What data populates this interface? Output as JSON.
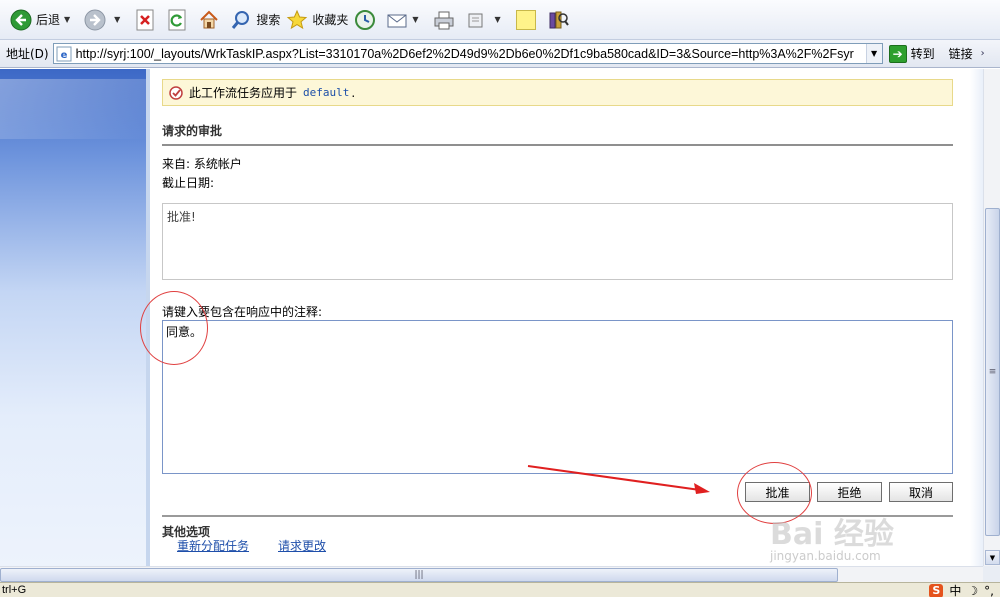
{
  "toolbar": {
    "back_label": "后退",
    "search_label": "搜索",
    "favorites_label": "收藏夹"
  },
  "address_bar": {
    "label": "地址(D)",
    "url": "http://syrj:100/_layouts/WrkTaskIP.aspx?List=3310170a%2D6ef2%2D49d9%2Db6e0%2Df1c9ba580cad&ID=3&Source=http%3A%2F%2Fsyr",
    "go_label": "转到",
    "links_label": "链接"
  },
  "notice": {
    "text": "此工作流任务应用于",
    "target": "default",
    "dot": "."
  },
  "task": {
    "title": "请求的审批",
    "from": "来自: 系统帐户",
    "due": "截止日期:",
    "message": "批准!"
  },
  "comment": {
    "label": "请键入要包含在响应中的注释:",
    "value": "同意。"
  },
  "buttons": {
    "approve": "批准",
    "reject": "拒绝",
    "cancel": "取消"
  },
  "other_options": {
    "title": "其他选项",
    "reassign": "重新分配任务",
    "request_change": "请求更改"
  },
  "watermark": {
    "main": "Bai 经验",
    "sub": "jingyan.baidu.com"
  },
  "statusbar": {
    "text": "trl+G",
    "ime_label": "中"
  },
  "colors": {
    "notice_bg": "#fdf7d8",
    "link": "#1f4faa",
    "annotation": "#e04040",
    "left_panel": "#3c68c6"
  }
}
